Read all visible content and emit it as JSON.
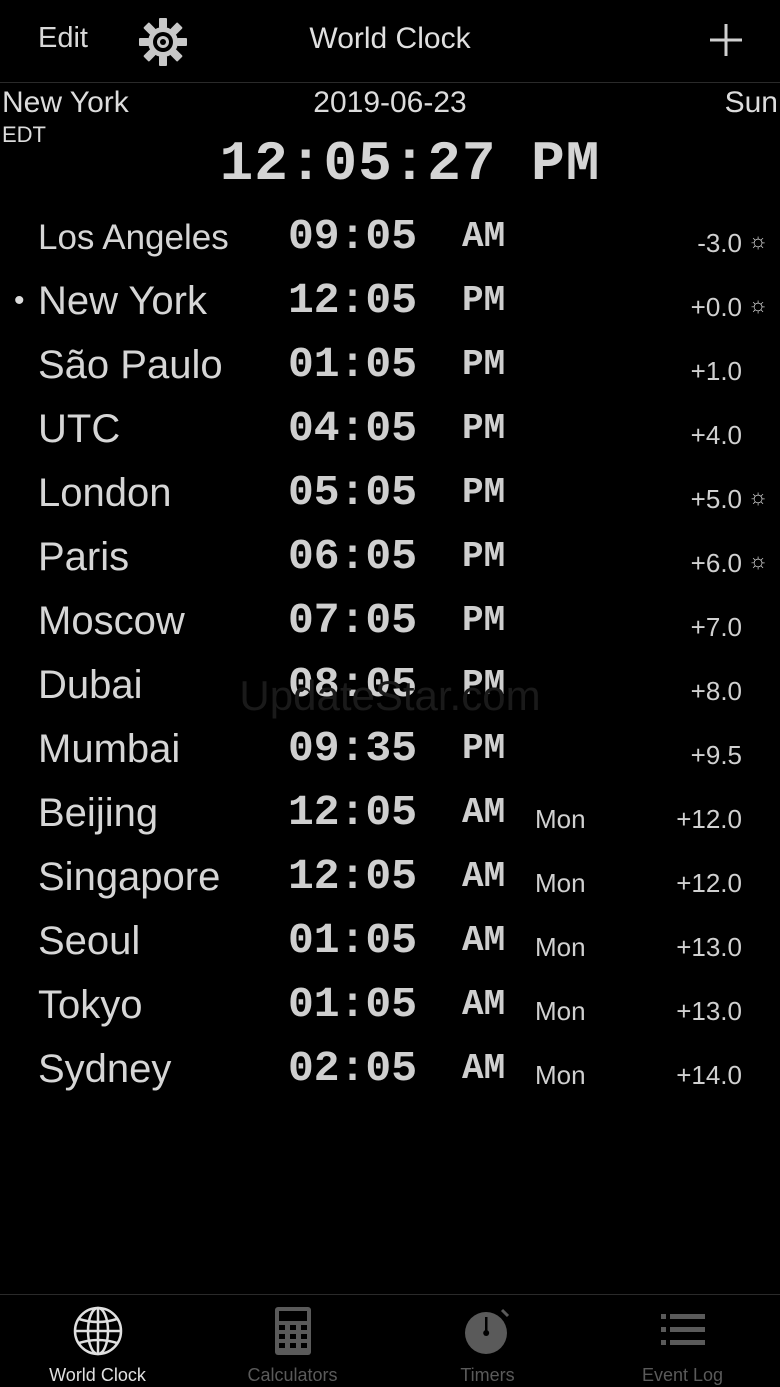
{
  "nav": {
    "edit_label": "Edit",
    "title": "World Clock",
    "settings_icon": "gear-icon",
    "add_icon": "plus-icon"
  },
  "current": {
    "city": "New York",
    "date": "2019-06-23",
    "day": "Sun",
    "zone": "EDT",
    "time": "12:05:27 PM"
  },
  "clocks": [
    {
      "city": "Los Angeles",
      "time": "09:05",
      "ampm": "AM",
      "day": "",
      "offset": "-3.0",
      "dst": true,
      "current": false
    },
    {
      "city": "New York",
      "time": "12:05",
      "ampm": "PM",
      "day": "",
      "offset": "+0.0",
      "dst": true,
      "current": true
    },
    {
      "city": "São Paulo",
      "time": "01:05",
      "ampm": "PM",
      "day": "",
      "offset": "+1.0",
      "dst": false,
      "current": false
    },
    {
      "city": "UTC",
      "time": "04:05",
      "ampm": "PM",
      "day": "",
      "offset": "+4.0",
      "dst": false,
      "current": false
    },
    {
      "city": "London",
      "time": "05:05",
      "ampm": "PM",
      "day": "",
      "offset": "+5.0",
      "dst": true,
      "current": false
    },
    {
      "city": "Paris",
      "time": "06:05",
      "ampm": "PM",
      "day": "",
      "offset": "+6.0",
      "dst": true,
      "current": false
    },
    {
      "city": "Moscow",
      "time": "07:05",
      "ampm": "PM",
      "day": "",
      "offset": "+7.0",
      "dst": false,
      "current": false
    },
    {
      "city": "Dubai",
      "time": "08:05",
      "ampm": "PM",
      "day": "",
      "offset": "+8.0",
      "dst": false,
      "current": false
    },
    {
      "city": "Mumbai",
      "time": "09:35",
      "ampm": "PM",
      "day": "",
      "offset": "+9.5",
      "dst": false,
      "current": false
    },
    {
      "city": "Beijing",
      "time": "12:05",
      "ampm": "AM",
      "day": "Mon",
      "offset": "+12.0",
      "dst": false,
      "current": false
    },
    {
      "city": "Singapore",
      "time": "12:05",
      "ampm": "AM",
      "day": "Mon",
      "offset": "+12.0",
      "dst": false,
      "current": false
    },
    {
      "city": "Seoul",
      "time": "01:05",
      "ampm": "AM",
      "day": "Mon",
      "offset": "+13.0",
      "dst": false,
      "current": false
    },
    {
      "city": "Tokyo",
      "time": "01:05",
      "ampm": "AM",
      "day": "Mon",
      "offset": "+13.0",
      "dst": false,
      "current": false
    },
    {
      "city": "Sydney",
      "time": "02:05",
      "ampm": "AM",
      "day": "Mon",
      "offset": "+14.0",
      "dst": false,
      "current": false
    }
  ],
  "current_marker": "•",
  "dst_symbol": "☼",
  "watermark": "UpdateStar.com",
  "tabs": [
    {
      "label": "World Clock",
      "icon": "globe-icon",
      "active": true
    },
    {
      "label": "Calculators",
      "icon": "calculator-icon",
      "active": false
    },
    {
      "label": "Timers",
      "icon": "stopwatch-icon",
      "active": false
    },
    {
      "label": "Event Log",
      "icon": "list-icon",
      "active": false
    }
  ],
  "colors": {
    "background": "#000000",
    "text": "#d6d6d6",
    "inactive_tab": "#5a5a5a"
  }
}
